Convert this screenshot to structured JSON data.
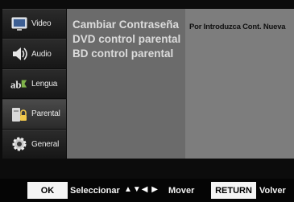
{
  "sidebar": {
    "items": [
      {
        "label": "Video",
        "icon": "monitor-icon"
      },
      {
        "label": "Audio",
        "icon": "speaker-icon"
      },
      {
        "label": "Lengua",
        "icon": "language-abc-icon"
      },
      {
        "label": "Parental",
        "icon": "parental-lock-icon"
      },
      {
        "label": "General",
        "icon": "gear-icon"
      }
    ]
  },
  "menu": {
    "items": [
      "Cambiar Contraseña",
      "DVD control parental",
      "BD control parental"
    ]
  },
  "detail": {
    "text": "Por Introduzca Cont. Nueva"
  },
  "footer": {
    "ok_key": "OK",
    "ok_label": "Seleccionar",
    "arrows": "▲▼◀ ▶",
    "arrows_label": "Mover",
    "return_key": "RETURN",
    "return_label": "Volver"
  }
}
